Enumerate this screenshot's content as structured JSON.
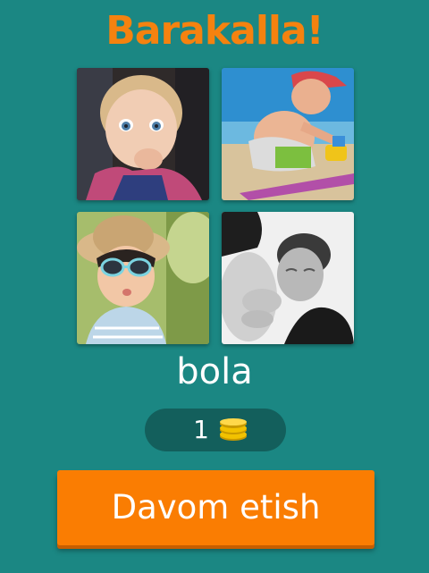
{
  "header": {
    "title": "Barakalla!"
  },
  "puzzle": {
    "images": [
      {
        "name": "baby-portrait-photo"
      },
      {
        "name": "child-playing-sand-photo"
      },
      {
        "name": "child-sunglasses-hat-photo"
      },
      {
        "name": "father-pregnant-belly-photo"
      }
    ],
    "answer": "bola"
  },
  "coins": {
    "count": "1",
    "icon": "coin-stack-icon",
    "color": "#f2c200"
  },
  "actions": {
    "continue_label": "Davom etish"
  },
  "theme": {
    "background": "#1b8783",
    "title_color": "#f5820f",
    "button_color": "#fa7d02",
    "pill_color": "#135f5c"
  }
}
